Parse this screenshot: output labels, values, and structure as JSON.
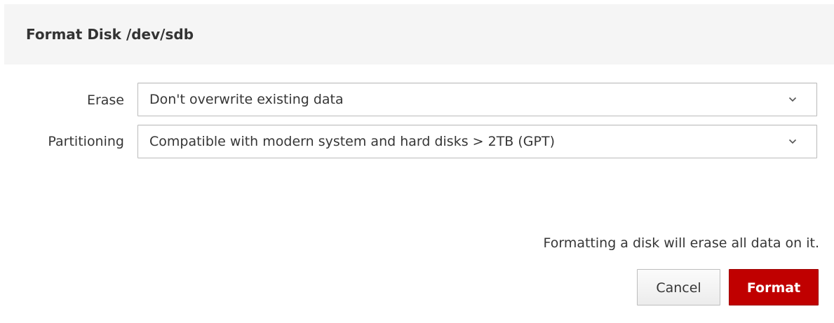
{
  "dialog": {
    "title": "Format Disk /dev/sdb"
  },
  "form": {
    "erase": {
      "label": "Erase",
      "value": "Don't overwrite existing data"
    },
    "partitioning": {
      "label": "Partitioning",
      "value": "Compatible with modern system and hard disks > 2TB (GPT)"
    }
  },
  "footer": {
    "warning": "Formatting a disk will erase all data on it.",
    "cancel_label": "Cancel",
    "format_label": "Format"
  },
  "colors": {
    "header_bg": "#f5f5f5",
    "primary_danger": "#c00000",
    "text": "#363636"
  },
  "icons": {
    "dropdown": "chevron-down-icon"
  }
}
